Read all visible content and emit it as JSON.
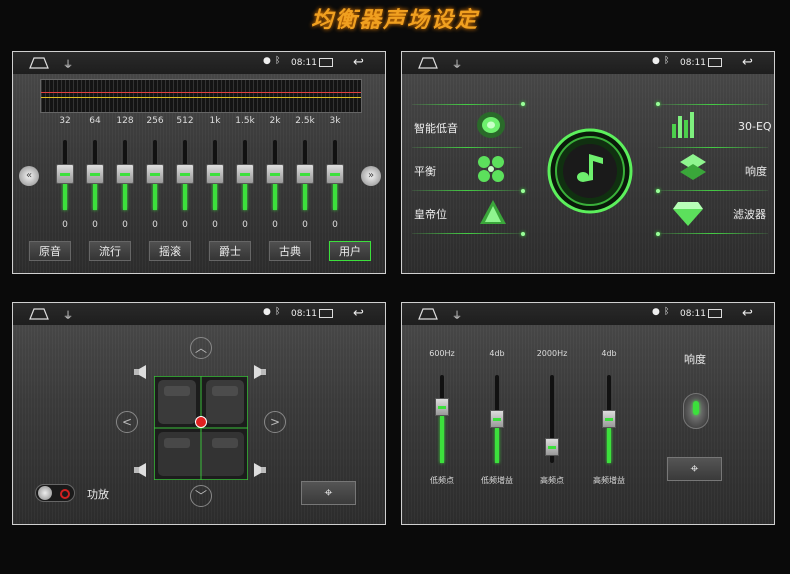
{
  "page_title": "均衡器声场设定",
  "status_bar": {
    "time": "08:11",
    "usb_icon": "usb-icon",
    "location_icon": "location-icon",
    "bluetooth_icon": "bluetooth-icon",
    "home_icon": "home-icon",
    "back_icon": "back-icon"
  },
  "eq": {
    "bands": [
      {
        "freq": "32",
        "value": "0"
      },
      {
        "freq": "64",
        "value": "0"
      },
      {
        "freq": "128",
        "value": "0"
      },
      {
        "freq": "256",
        "value": "0"
      },
      {
        "freq": "512",
        "value": "0"
      },
      {
        "freq": "1k",
        "value": "0"
      },
      {
        "freq": "1.5k",
        "value": "0"
      },
      {
        "freq": "2k",
        "value": "0"
      },
      {
        "freq": "2.5k",
        "value": "0"
      },
      {
        "freq": "3k",
        "value": "0"
      }
    ],
    "presets": [
      "原音",
      "流行",
      "摇滚",
      "爵士",
      "古典",
      "用户"
    ],
    "active_preset": "用户",
    "accent": "#3ce03c"
  },
  "menu": {
    "left": [
      "智能低音",
      "平衡",
      "皇帝位"
    ],
    "right": [
      "30-EQ",
      "响度",
      "滤波器"
    ]
  },
  "balance": {
    "amp_label": "功放"
  },
  "params": {
    "sliders": [
      {
        "top": "600Hz",
        "bottom": "低频点"
      },
      {
        "top": "4db",
        "bottom": "低频增益"
      },
      {
        "top": "2000Hz",
        "bottom": "高频点"
      },
      {
        "top": "4db",
        "bottom": "高频增益"
      }
    ],
    "loudness_label": "响度"
  }
}
